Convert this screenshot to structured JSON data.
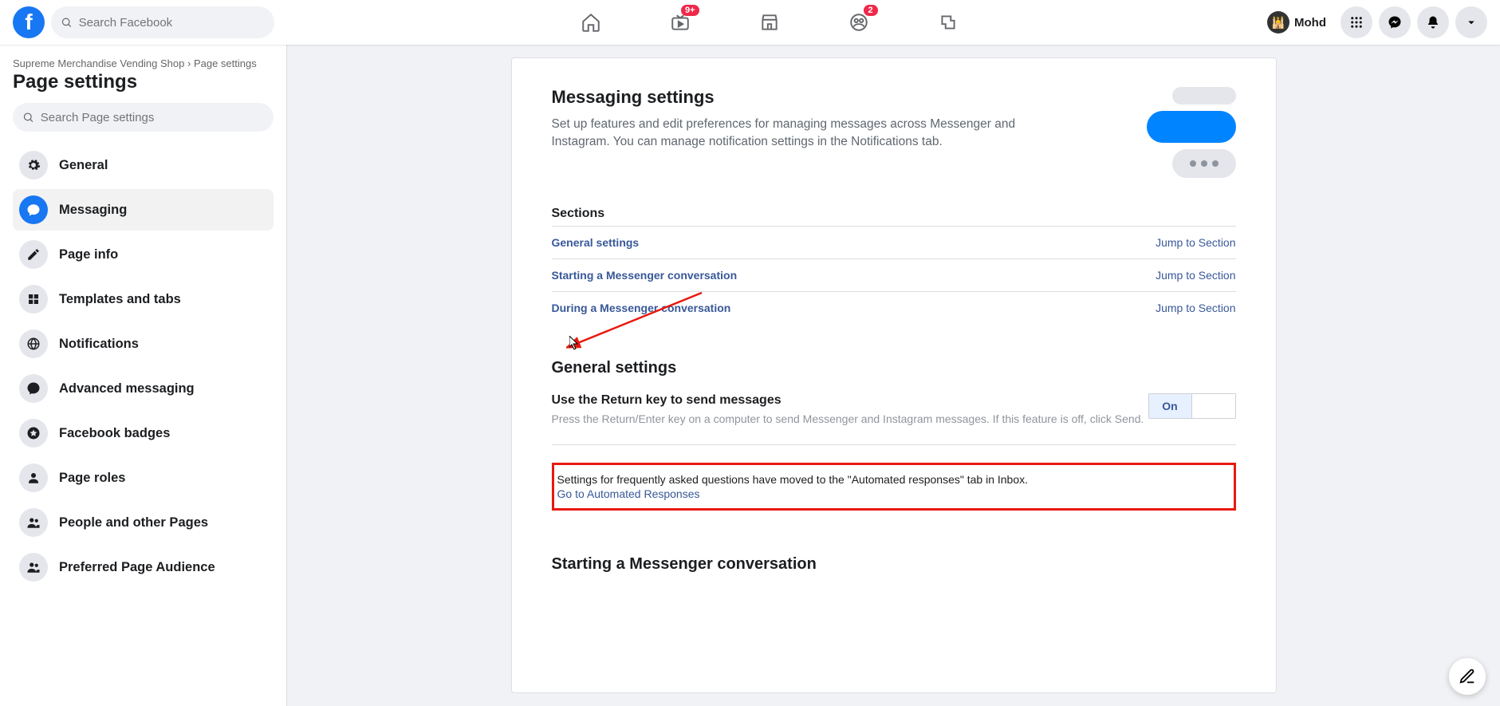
{
  "header": {
    "search_placeholder": "Search Facebook",
    "badges": {
      "watch": "9+",
      "groups": "2"
    },
    "profile_name": "Mohd"
  },
  "sidebar": {
    "breadcrumb_page": "Supreme Merchandise Vending Shop",
    "breadcrumb_sep": " › ",
    "breadcrumb_current": "Page settings",
    "title": "Page settings",
    "search_placeholder": "Search Page settings",
    "items": [
      {
        "label": "General"
      },
      {
        "label": "Messaging"
      },
      {
        "label": "Page info"
      },
      {
        "label": "Templates and tabs"
      },
      {
        "label": "Notifications"
      },
      {
        "label": "Advanced messaging"
      },
      {
        "label": "Facebook badges"
      },
      {
        "label": "Page roles"
      },
      {
        "label": "People and other Pages"
      },
      {
        "label": "Preferred Page Audience"
      }
    ]
  },
  "main": {
    "title": "Messaging settings",
    "description": "Set up features and edit preferences for managing messages across Messenger and Instagram. You can manage notification settings in the Notifications tab.",
    "sections_label": "Sections",
    "sections": [
      {
        "name": "General settings",
        "jump": "Jump to Section"
      },
      {
        "name": "Starting a Messenger conversation",
        "jump": "Jump to Section"
      },
      {
        "name": "During a Messenger conversation",
        "jump": "Jump to Section"
      }
    ],
    "general": {
      "heading": "General settings",
      "return_key_label": "Use the Return key to send messages",
      "return_key_desc": "Press the Return/Enter key on a computer to send Messenger and Instagram messages. If this feature is off, click Send.",
      "toggle_on": "On",
      "faq_notice": "Settings for frequently asked questions have moved to the \"Automated responses\" tab in Inbox.",
      "faq_link": "Go to Automated Responses"
    },
    "starting_heading": "Starting a Messenger conversation"
  }
}
